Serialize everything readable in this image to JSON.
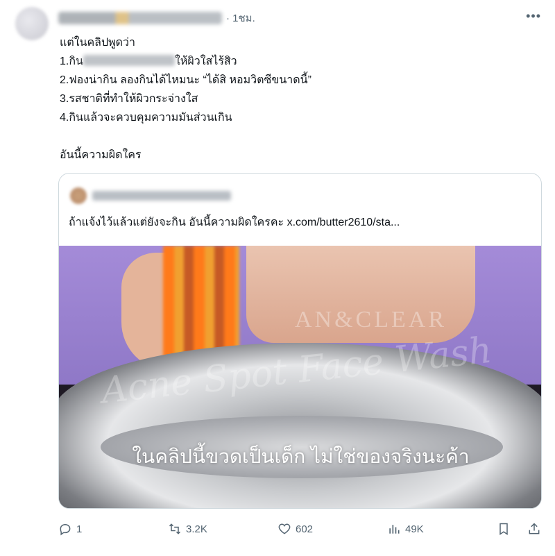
{
  "post": {
    "time": "· 1ชม.",
    "lines": [
      "แต่ในคลิปพูดว่า",
      "1.กิน",
      "ให้ผิวใสไร้สิว",
      "2.ฟองน่ากิน ลองกินได้ไหมนะ “ได้สิ หอมวิตซีขนาดนี้”",
      "3.รสชาติที่ทำให้ผิวกระจ่างใส",
      "4.กินแล้วจะควบคุมความมันส่วนเกิน",
      "อันนี้ความผิดใคร"
    ]
  },
  "quote": {
    "text": "ถ้าแจ้งไว้แล้วแต่ยังจะกิน อันนี้ความผิดใครคะ",
    "link": "x.com/butter2610/sta...",
    "video_watermark_top": "AN&CLEAR",
    "video_watermark_script": "Acne Spot Face Wash",
    "video_caption": "ในคลิปนี้ขวดเป็นเด็ก ไม่ใช่ของจริงนะค้า"
  },
  "actions": {
    "replies": "1",
    "reposts": "3.2K",
    "likes": "602",
    "views": "49K"
  },
  "icons": {
    "more": "more-horizontal-icon",
    "reply": "reply-icon",
    "repost": "repost-icon",
    "like": "heart-icon",
    "views": "views-bar-chart-icon",
    "bookmark": "bookmark-icon",
    "share": "share-icon"
  },
  "colors": {
    "text": "#0f1419",
    "secondary": "#536471",
    "border": "#cfd9de"
  }
}
